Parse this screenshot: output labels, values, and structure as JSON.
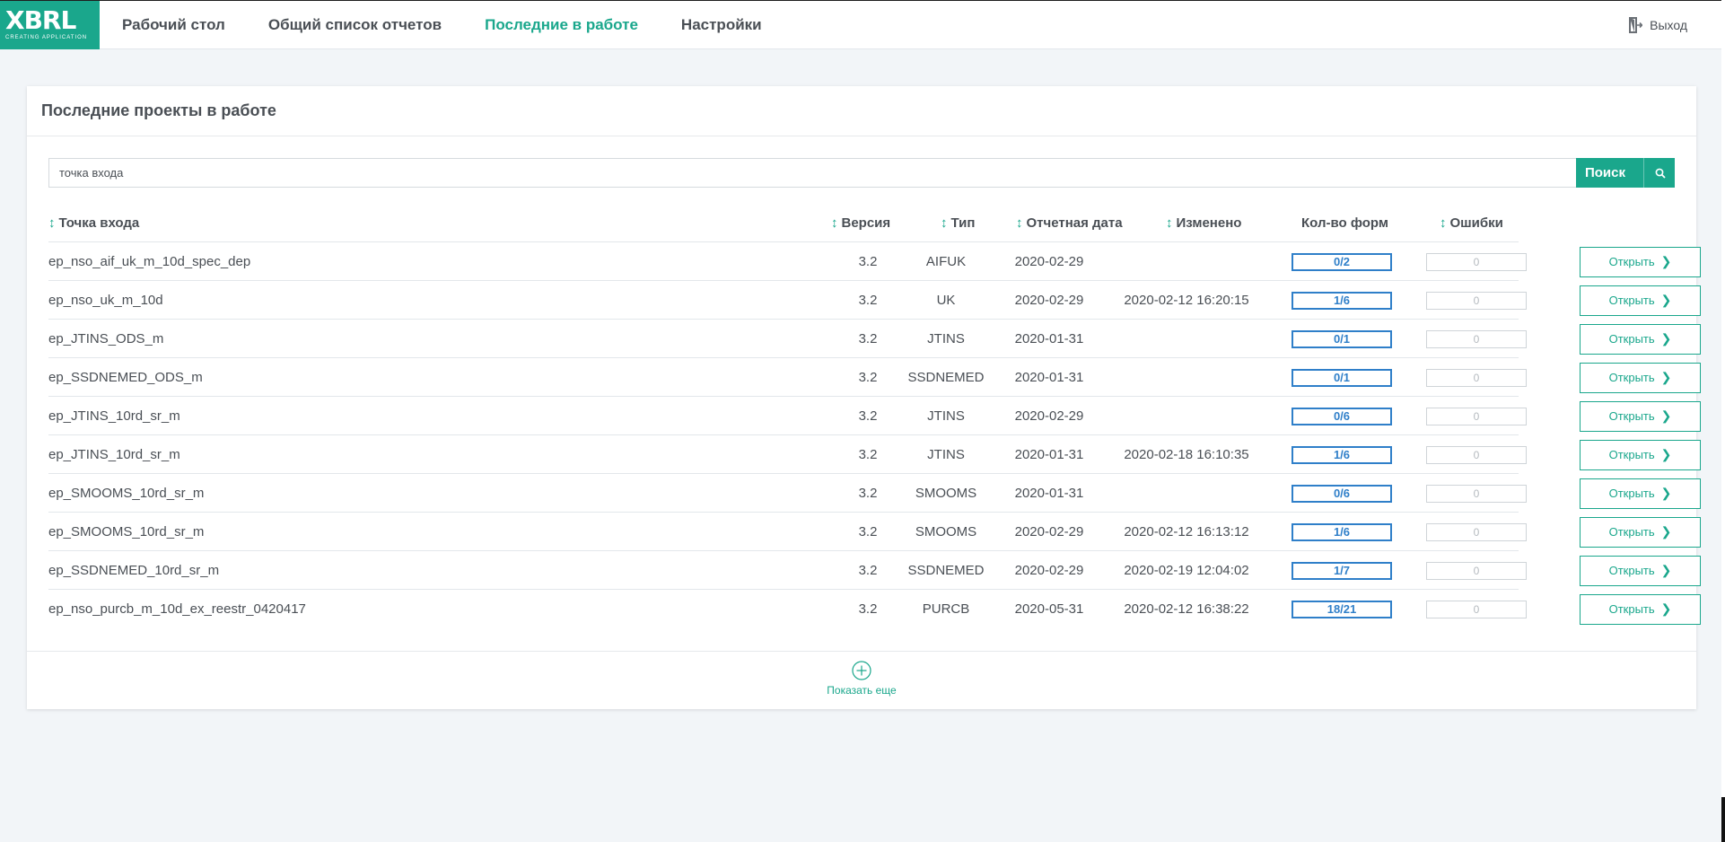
{
  "logo": {
    "text": "XBRL",
    "subtitle": "CREATING APPLICATION"
  },
  "nav": {
    "items": [
      {
        "label": "Рабочий стол"
      },
      {
        "label": "Общий список отчетов"
      },
      {
        "label": "Последние в работе"
      },
      {
        "label": "Настройки"
      }
    ],
    "active_index": 2,
    "logout_label": "Выход"
  },
  "card": {
    "title": "Последние проекты в работе"
  },
  "search": {
    "value": "точка входа",
    "button_label": "Поиск"
  },
  "table": {
    "headers": {
      "entry_point": "Точка входа",
      "version": "Версия",
      "type": "Тип",
      "report_date": "Отчетная дата",
      "modified": "Изменено",
      "forms_count": "Кол-во форм",
      "errors": "Ошибки"
    },
    "open_label": "Открыть",
    "rows": [
      {
        "entry_point": "ep_nso_aif_uk_m_10d_spec_dep",
        "version": "3.2",
        "type": "AIFUK",
        "report_date": "2020-02-29",
        "modified": "",
        "forms": "0/2",
        "errors": "0"
      },
      {
        "entry_point": "ep_nso_uk_m_10d",
        "version": "3.2",
        "type": "UK",
        "report_date": "2020-02-29",
        "modified": "2020-02-12 16:20:15",
        "forms": "1/6",
        "errors": "0"
      },
      {
        "entry_point": "ep_JTINS_ODS_m",
        "version": "3.2",
        "type": "JTINS",
        "report_date": "2020-01-31",
        "modified": "",
        "forms": "0/1",
        "errors": "0"
      },
      {
        "entry_point": "ep_SSDNEMED_ODS_m",
        "version": "3.2",
        "type": "SSDNEMED",
        "report_date": "2020-01-31",
        "modified": "",
        "forms": "0/1",
        "errors": "0"
      },
      {
        "entry_point": "ep_JTINS_10rd_sr_m",
        "version": "3.2",
        "type": "JTINS",
        "report_date": "2020-02-29",
        "modified": "",
        "forms": "0/6",
        "errors": "0"
      },
      {
        "entry_point": "ep_JTINS_10rd_sr_m",
        "version": "3.2",
        "type": "JTINS",
        "report_date": "2020-01-31",
        "modified": "2020-02-18 16:10:35",
        "forms": "1/6",
        "errors": "0"
      },
      {
        "entry_point": "ep_SMOOMS_10rd_sr_m",
        "version": "3.2",
        "type": "SMOOMS",
        "report_date": "2020-01-31",
        "modified": "",
        "forms": "0/6",
        "errors": "0"
      },
      {
        "entry_point": "ep_SMOOMS_10rd_sr_m",
        "version": "3.2",
        "type": "SMOOMS",
        "report_date": "2020-02-29",
        "modified": "2020-02-12 16:13:12",
        "forms": "1/6",
        "errors": "0"
      },
      {
        "entry_point": "ep_SSDNEMED_10rd_sr_m",
        "version": "3.2",
        "type": "SSDNEMED",
        "report_date": "2020-02-29",
        "modified": "2020-02-19 12:04:02",
        "forms": "1/7",
        "errors": "0"
      },
      {
        "entry_point": "ep_nso_purcb_m_10d_ex_reestr_0420417",
        "version": "3.2",
        "type": "PURCB",
        "report_date": "2020-05-31",
        "modified": "2020-02-12 16:38:22",
        "forms": "18/21",
        "errors": "0"
      }
    ]
  },
  "footer": {
    "show_more_label": "Показать еще"
  },
  "colors": {
    "accent": "#1aa78c",
    "forms_border": "#2f7fc9"
  }
}
